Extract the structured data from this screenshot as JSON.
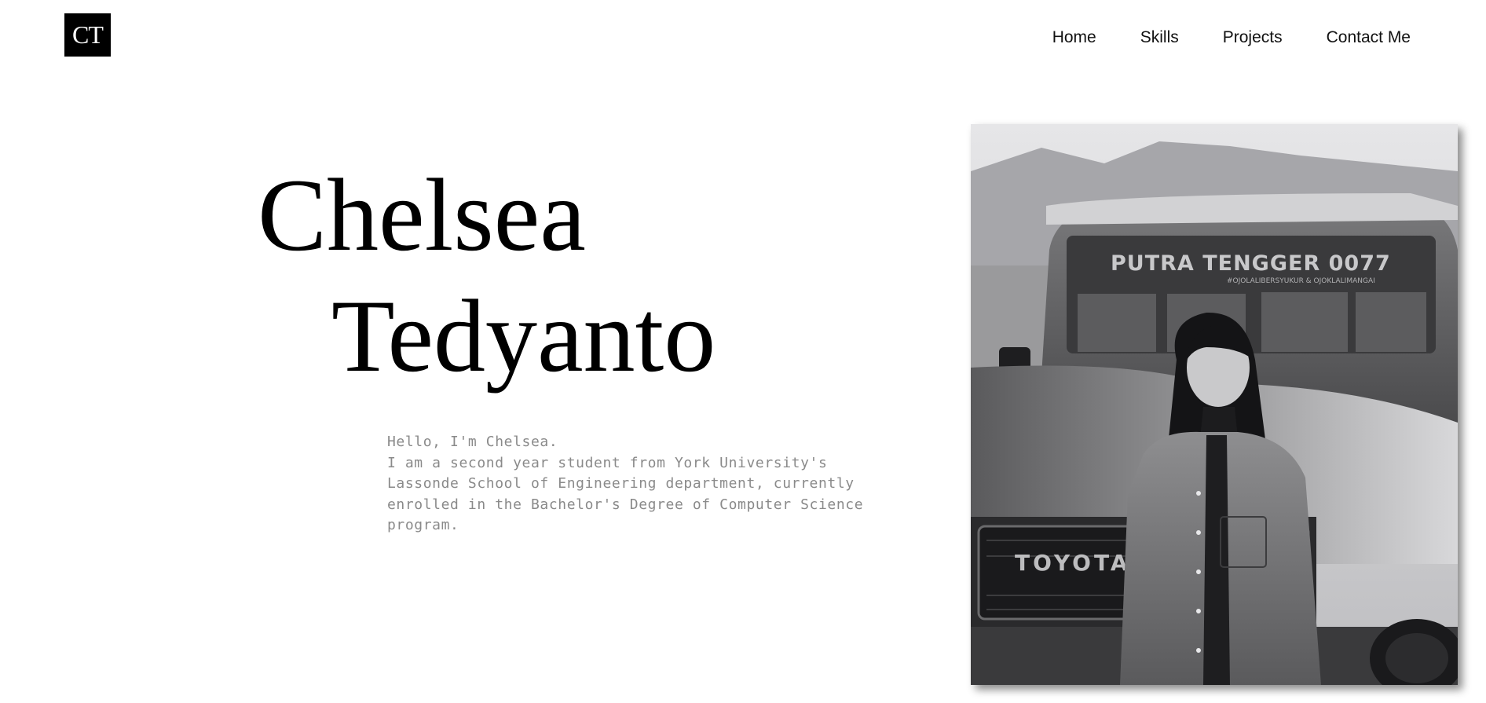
{
  "header": {
    "logo_text": "CT",
    "nav": [
      {
        "label": "Home"
      },
      {
        "label": "Skills"
      },
      {
        "label": "Projects"
      },
      {
        "label": "Contact Me"
      }
    ]
  },
  "hero": {
    "first_name": "Chelsea",
    "last_name": "Tedyanto",
    "intro_greeting": "Hello, I'm Chelsea.",
    "intro_body": "I am a second year student from York University's Lassonde School of Engineering department, currently enrolled in the Bachelor's Degree of Computer Science program."
  },
  "photo": {
    "windshield_text": "PUTRA TENGGER 0077",
    "windshield_subtext": "#OJOLALIBERSYUKUR & OJOKLALIMANGAI",
    "grille_text": "TOYOTA"
  }
}
